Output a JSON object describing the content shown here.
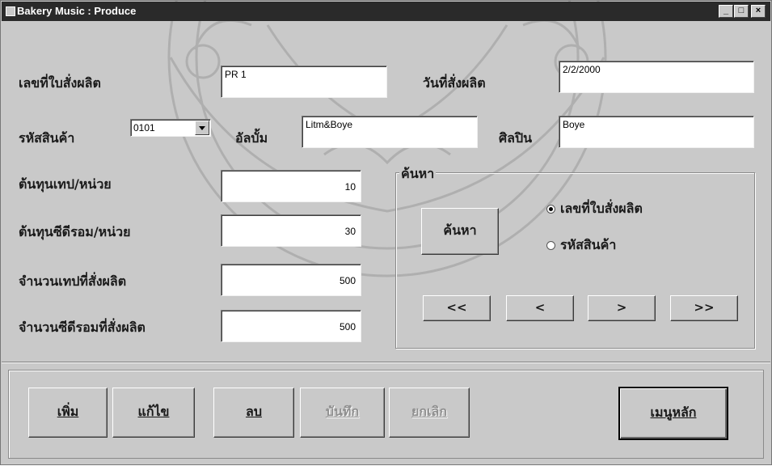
{
  "window": {
    "title": "Bakery Music : Produce",
    "controls": [
      "_",
      "□",
      "×"
    ]
  },
  "form": {
    "order_no_label": "เลขที่ใบสั่งผลิต",
    "order_no_value": "PR 1",
    "order_date_label": "วันที่สั่งผลิต",
    "order_date_value": "2/2/2000",
    "product_code_label": "รหัสสินค้า",
    "product_code_value": "0101",
    "album_label": "อัลบั้ม",
    "album_value": "Litm&Boye",
    "artist_label": "ศิลปิน",
    "artist_value": "Boye",
    "tape_cost_label": "ต้นทุนเทป/หน่วย",
    "tape_cost_value": "10",
    "cd_cost_label": "ต้นทุนซีดีรอม/หน่วย",
    "cd_cost_value": "30",
    "tape_qty_label": "จำนวนเทปที่สั่งผลิต",
    "tape_qty_value": "500",
    "cd_qty_label": "จำนวนซีดีรอมที่สั่งผลิต",
    "cd_qty_value": "500"
  },
  "search": {
    "group_label": "ค้นหา",
    "button_label": "ค้นหา",
    "option_order_no": "เลขที่ใบสั่งผลิต",
    "option_product_code": "รหัสสินค้า",
    "selected": "order_no"
  },
  "nav": {
    "first": "<<",
    "prev": "<",
    "next": ">",
    "last": ">>"
  },
  "actions": {
    "add": "เพิ่ม",
    "edit": "แก้ไข",
    "delete": "ลบ",
    "save": "บันทึก",
    "cancel": "ยกเลิก",
    "main_menu": "เมนูหลัก"
  },
  "colors": {
    "window_bg": "#c9c9c9",
    "titlebar_bg": "#2a2a2a",
    "field_bg": "#ffffff",
    "disabled_text": "#8f8f8f"
  }
}
